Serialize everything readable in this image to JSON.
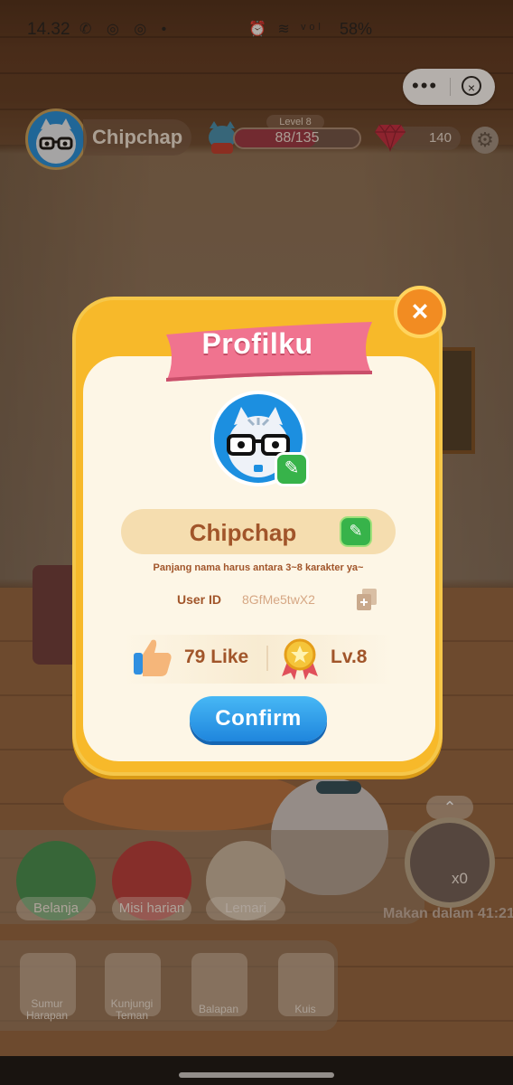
{
  "status_bar": {
    "time": "14.32",
    "left_icons": "✆ ◎ ◎ •",
    "right_icons": "⏰ ≋ ᵛᵒˡ",
    "battery": "58%"
  },
  "mini_program": {
    "more_label": "•••",
    "close_label": "×"
  },
  "hud": {
    "player_name": "Chipchap",
    "level_label": "Level 8",
    "xp_text": "88/135",
    "xp_fraction": 0.652,
    "gems": "140",
    "settings_icon": "gear-icon"
  },
  "modal": {
    "title": "Profilku",
    "close_label": "×",
    "name": "Chipchap",
    "name_hint": "Panjang nama harus antara 3~8 karakter ya~",
    "user_id_label": "User ID",
    "user_id_value": "8GfMe5twX2",
    "likes": "79 Like",
    "level": "Lv.8",
    "confirm_label": "Confirm"
  },
  "menu": {
    "items": [
      {
        "label": "Belanja",
        "icon": "market-icon"
      },
      {
        "label": "Misi harian",
        "icon": "gift-icon"
      },
      {
        "label": "Lemari",
        "icon": "hanger-icon"
      }
    ],
    "food_count": "x0",
    "feed_text": "Makan dalam 41:21"
  },
  "bottom": {
    "items": [
      {
        "label": "Sumur Harapan",
        "icon": "wishing-well-icon"
      },
      {
        "label": "Kunjungi Teman",
        "icon": "friends-icon"
      },
      {
        "label": "Balapan",
        "icon": "gamepad-icon"
      },
      {
        "label": "Kuis",
        "icon": "quiz-icon"
      }
    ]
  },
  "colors": {
    "modal_bg": "#f7b92a",
    "ribbon": "#f0738f",
    "confirm": "#1f86dd",
    "edit_green": "#37b34a",
    "text_brown": "#a1552a"
  }
}
